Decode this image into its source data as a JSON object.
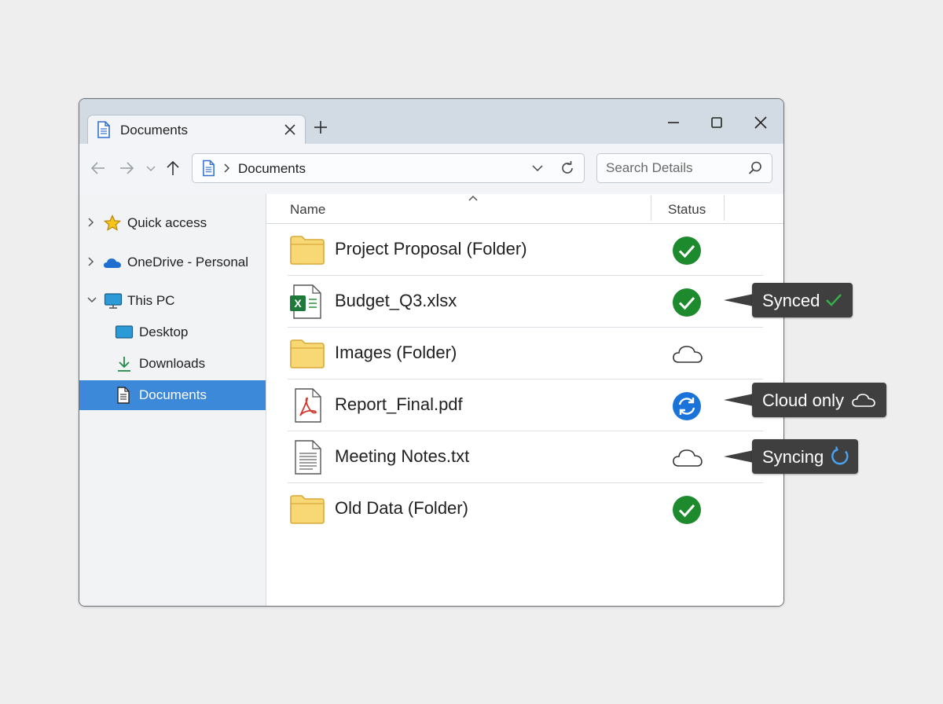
{
  "tab": {
    "title": "Documents"
  },
  "address": {
    "path": "Documents"
  },
  "search": {
    "placeholder": "Search Details"
  },
  "sidebar": {
    "items": [
      {
        "label": "Quick access",
        "icon": "star-icon"
      },
      {
        "label": "OneDrive - Personal",
        "icon": "cloud-icon"
      },
      {
        "label": "This PC",
        "icon": "monitor-icon"
      },
      {
        "label": "Desktop",
        "icon": "desktop-icon"
      },
      {
        "label": "Downloads",
        "icon": "download-icon"
      },
      {
        "label": "Documents",
        "icon": "document-icon",
        "selected": true
      }
    ]
  },
  "columns": {
    "name": "Name",
    "status": "Status"
  },
  "files": [
    {
      "name": "Project Proposal (Folder)",
      "icon": "folder-icon",
      "status": "synced"
    },
    {
      "name": "Budget_Q3.xlsx",
      "icon": "excel-file-icon",
      "status": "synced"
    },
    {
      "name": "Images (Folder)",
      "icon": "folder-icon",
      "status": "cloud-only"
    },
    {
      "name": "Report_Final.pdf",
      "icon": "pdf-file-icon",
      "status": "syncing"
    },
    {
      "name": "Meeting Notes.txt",
      "icon": "text-file-icon",
      "status": "cloud-only"
    },
    {
      "name": "Old Data (Folder)",
      "icon": "folder-icon",
      "status": "synced"
    }
  ],
  "callouts": [
    {
      "label": "Synced",
      "icon": "check-icon"
    },
    {
      "label": "Cloud only",
      "icon": "cloud-icon"
    },
    {
      "label": "Syncing",
      "icon": "sync-icon"
    }
  ],
  "colors": {
    "accent": "#3c88d9",
    "synced_green": "#1e8a2e",
    "syncing_blue": "#1a73d9",
    "folder_yellow": "#f8d775",
    "callout_bg": "#3f3f3f"
  }
}
